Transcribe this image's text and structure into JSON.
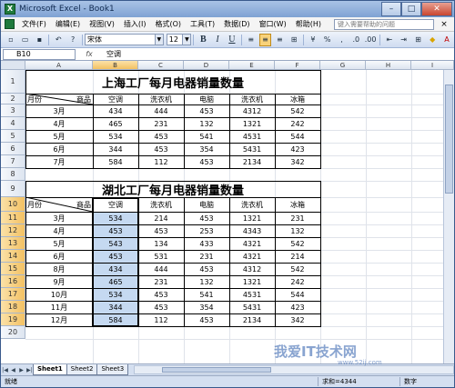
{
  "window": {
    "title": "Microsoft Excel - Book1",
    "icon": "excel-icon"
  },
  "menu": {
    "items": [
      "文件(F)",
      "编辑(E)",
      "视图(V)",
      "插入(I)",
      "格式(O)",
      "工具(T)",
      "数据(D)",
      "窗口(W)",
      "帮助(H)"
    ],
    "help_placeholder": "键入需要帮助的问题"
  },
  "toolbar": {
    "font": "宋体",
    "size": "12",
    "bold": "B",
    "italic": "I",
    "underline": "U"
  },
  "formula_bar": {
    "cell_ref": "B10",
    "fx": "fx",
    "content": "空调"
  },
  "columns": [
    "A",
    "B",
    "C",
    "D",
    "E",
    "F",
    "G",
    "H",
    "I"
  ],
  "rows": [
    "1",
    "2",
    "3",
    "4",
    "5",
    "6",
    "7",
    "8",
    "9",
    "10",
    "11",
    "12",
    "13",
    "14",
    "15",
    "16",
    "17",
    "18",
    "19",
    "20"
  ],
  "table1": {
    "title": "上海工厂每月电器销量数量",
    "corner_left": "月份",
    "corner_right": "商品",
    "headers": [
      "空调",
      "洗衣机",
      "电脑",
      "洗衣机",
      "冰箱"
    ],
    "rows": [
      {
        "month": "3月",
        "values": [
          "434",
          "444",
          "453",
          "4312",
          "542"
        ]
      },
      {
        "month": "4月",
        "values": [
          "465",
          "231",
          "132",
          "1321",
          "242"
        ]
      },
      {
        "month": "5月",
        "values": [
          "534",
          "453",
          "541",
          "4531",
          "544"
        ]
      },
      {
        "month": "6月",
        "values": [
          "344",
          "453",
          "354",
          "5431",
          "423"
        ]
      },
      {
        "month": "7月",
        "values": [
          "584",
          "112",
          "453",
          "2134",
          "342"
        ]
      }
    ]
  },
  "table2": {
    "title": "湖北工厂每月电器销量数量",
    "corner_left": "月份",
    "corner_right": "商品",
    "headers": [
      "空调",
      "洗衣机",
      "电脑",
      "洗衣机",
      "冰箱"
    ],
    "rows": [
      {
        "month": "3月",
        "values": [
          "534",
          "214",
          "453",
          "1321",
          "231"
        ]
      },
      {
        "month": "4月",
        "values": [
          "453",
          "453",
          "253",
          "4343",
          "132"
        ]
      },
      {
        "month": "5月",
        "values": [
          "543",
          "134",
          "433",
          "4321",
          "542"
        ]
      },
      {
        "month": "6月",
        "values": [
          "453",
          "531",
          "231",
          "4321",
          "214"
        ]
      },
      {
        "month": "8月",
        "values": [
          "434",
          "444",
          "453",
          "4312",
          "542"
        ]
      },
      {
        "month": "9月",
        "values": [
          "465",
          "231",
          "132",
          "1321",
          "242"
        ]
      },
      {
        "month": "10月",
        "values": [
          "534",
          "453",
          "541",
          "4531",
          "544"
        ]
      },
      {
        "month": "11月",
        "values": [
          "344",
          "453",
          "354",
          "5431",
          "423"
        ]
      },
      {
        "month": "12月",
        "values": [
          "584",
          "112",
          "453",
          "2134",
          "342"
        ]
      }
    ]
  },
  "sheets": [
    "Sheet1",
    "Sheet2",
    "Sheet3"
  ],
  "status": {
    "ready": "就绪",
    "sum": "求和=4344",
    "mode": "数字"
  },
  "watermark": {
    "text": "我爱IT技术网",
    "url": "www.52ij.com"
  }
}
